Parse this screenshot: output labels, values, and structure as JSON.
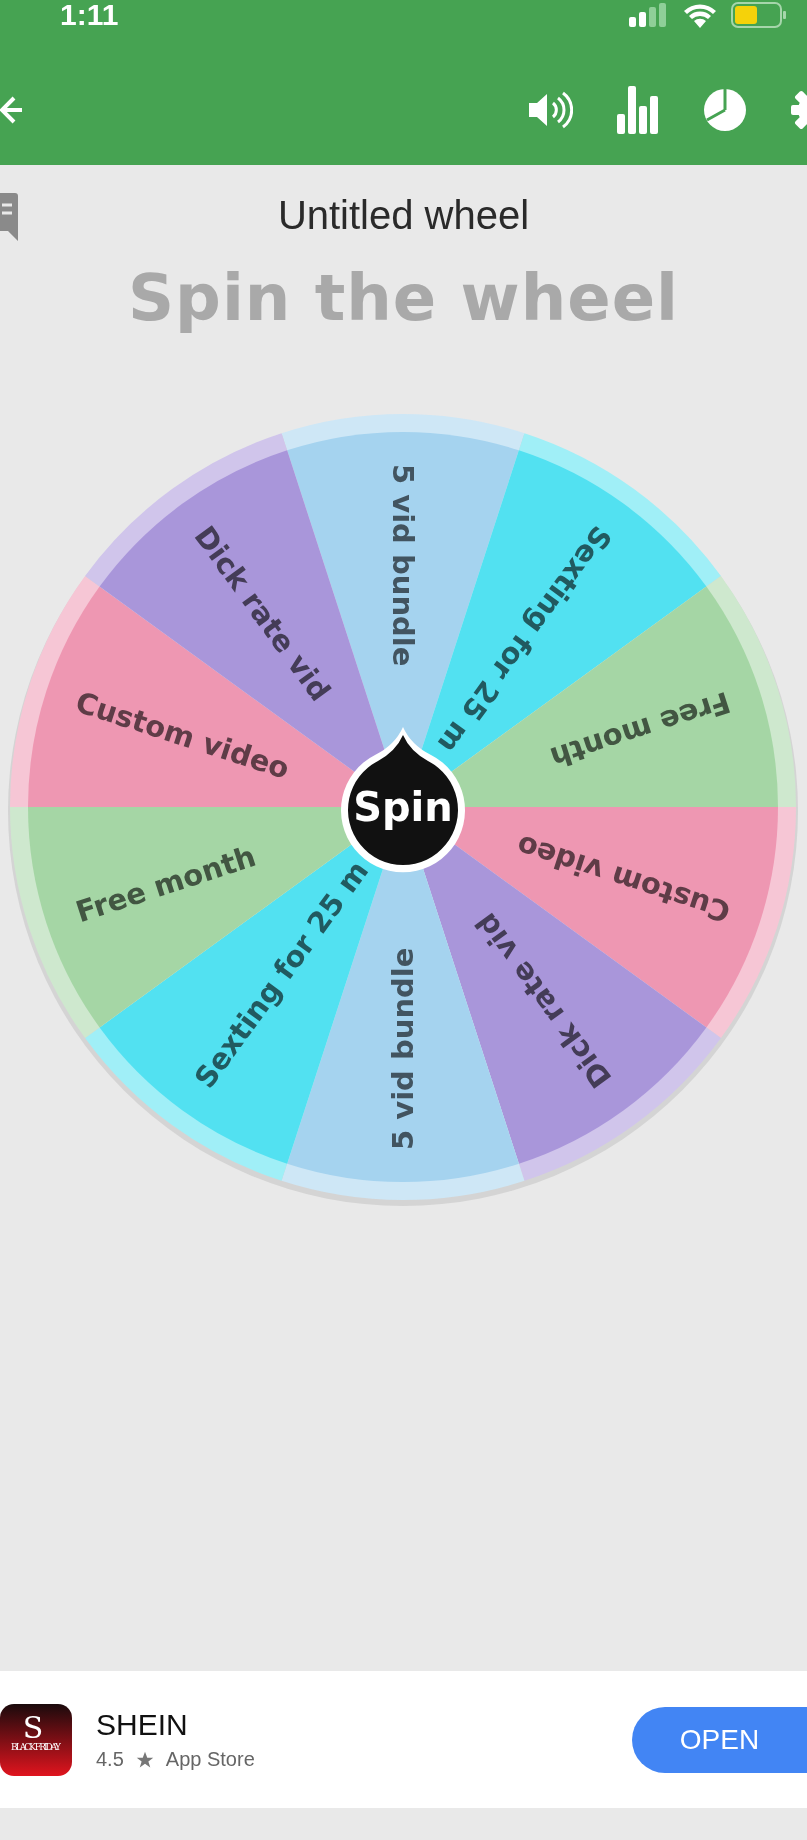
{
  "status_bar": {
    "time": "1:11"
  },
  "title": "Untitled wheel",
  "heading": "Spin the wheel",
  "wheel": {
    "segments": [
      {
        "label": "5 vid bundle",
        "color": "#a5d3ef"
      },
      {
        "label": "Sexting for 25 m",
        "color": "#52e1f1"
      },
      {
        "label": "Free month",
        "color": "#a5d6a5"
      },
      {
        "label": "Custom video",
        "color": "#ee97b2"
      },
      {
        "label": "Dick rate vid",
        "color": "#a996da"
      },
      {
        "label": "5 vid bundle",
        "color": "#a5d3ef"
      },
      {
        "label": "Sexting for 25 m",
        "color": "#52e1f1"
      },
      {
        "label": "Free month",
        "color": "#a5d6a5"
      },
      {
        "label": "Custom video",
        "color": "#ee97b2"
      },
      {
        "label": "Dick rate vid",
        "color": "#a996da"
      }
    ],
    "spin_button": "Spin"
  },
  "ad": {
    "icon_letter": "S",
    "icon_caption": "BLACK FRIDAY",
    "name": "SHEIN",
    "rating": "4.5",
    "store": "App Store",
    "button": "OPEN"
  }
}
